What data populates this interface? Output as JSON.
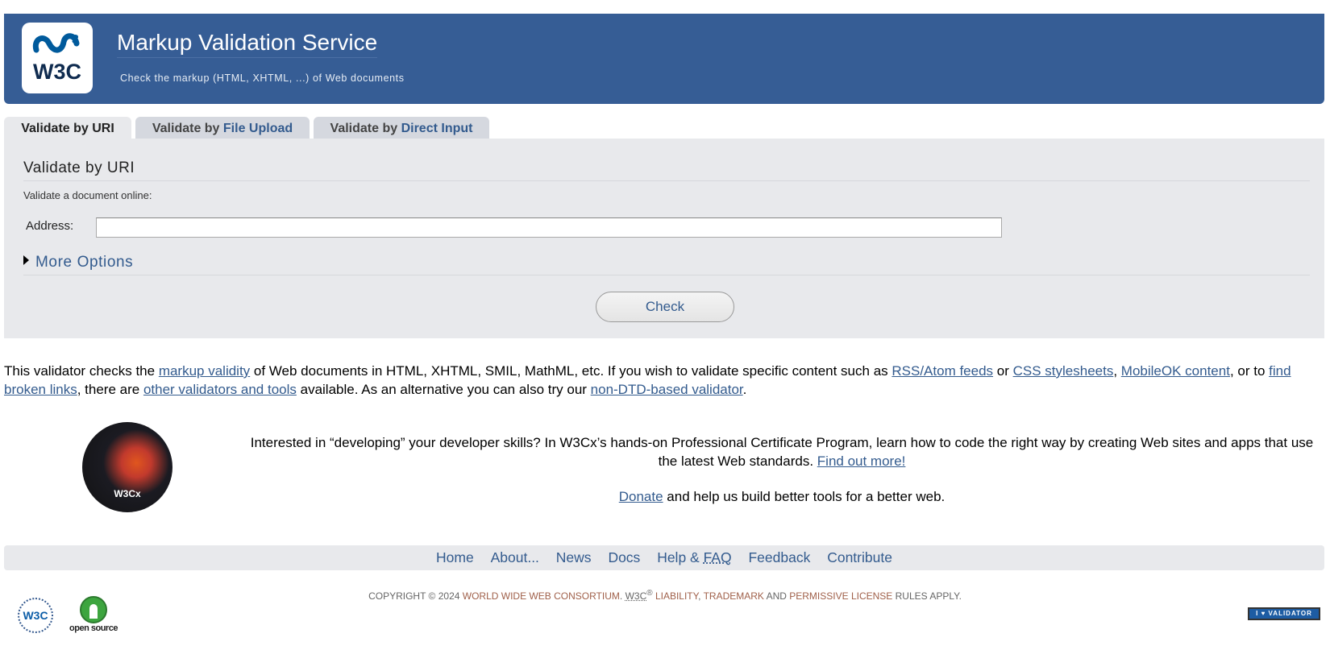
{
  "header": {
    "logo_text": "W3C",
    "title": "Markup Validation Service",
    "subtitle": "Check the markup (HTML, XHTML, ...) of Web documents"
  },
  "tabs": [
    {
      "prefix": "Validate by ",
      "highlight": "URI"
    },
    {
      "prefix": "Validate by ",
      "highlight": "File Upload"
    },
    {
      "prefix": "Validate by ",
      "highlight": "Direct Input"
    }
  ],
  "panel": {
    "title": "Validate by URI",
    "label": "Validate a document online:",
    "address_label": "Address:",
    "address_value": "",
    "more_options": "More Options",
    "check_label": "Check"
  },
  "intro": {
    "t1": "This validator checks the ",
    "l1": "markup validity",
    "t2": " of Web documents in HTML, XHTML, SMIL, MathML, etc. If you wish to validate specific content such as ",
    "l2": "RSS/Atom feeds",
    "t3": " or ",
    "l3": "CSS stylesheets",
    "t4": ", ",
    "l4": "MobileOK content",
    "t5": ", or to ",
    "l5": "find broken links",
    "t6": ", there are ",
    "l6": "other validators and tools",
    "t7": " available. As an alternative you can also try our ",
    "l7": "non-DTD-based validator",
    "t8": "."
  },
  "promo": {
    "badge_text": "W3Cx",
    "text": "Interested in “developing” your developer skills? In W3Cx’s hands-on Professional Certificate Program, learn how to code the right way by creating Web sites and apps that use the latest Web standards. ",
    "link": "Find out more!",
    "donate_link": "Donate",
    "donate_text": " and help us build better tools for a better web."
  },
  "nav": {
    "items": [
      "Home",
      "About...",
      "News",
      "Docs",
      "Help & ",
      "FAQ",
      "Feedback",
      "Contribute"
    ]
  },
  "copyright": {
    "c1": "COPYRIGHT © 2024 ",
    "l1": "WORLD WIDE WEB CONSORTIUM",
    "c2": ". ",
    "abbr": "W3C",
    "sup": "®",
    "c3": " ",
    "l2": "LIABILITY",
    "c4": ", ",
    "l3": "TRADEMARK",
    "c5": " AND ",
    "l4": "PERMISSIVE LICENSE",
    "c6": " RULES APPLY."
  },
  "footer_logos": {
    "w3c_seal": "W3C",
    "open_source": "open source",
    "badge": "I ♥ VALIDATOR"
  }
}
